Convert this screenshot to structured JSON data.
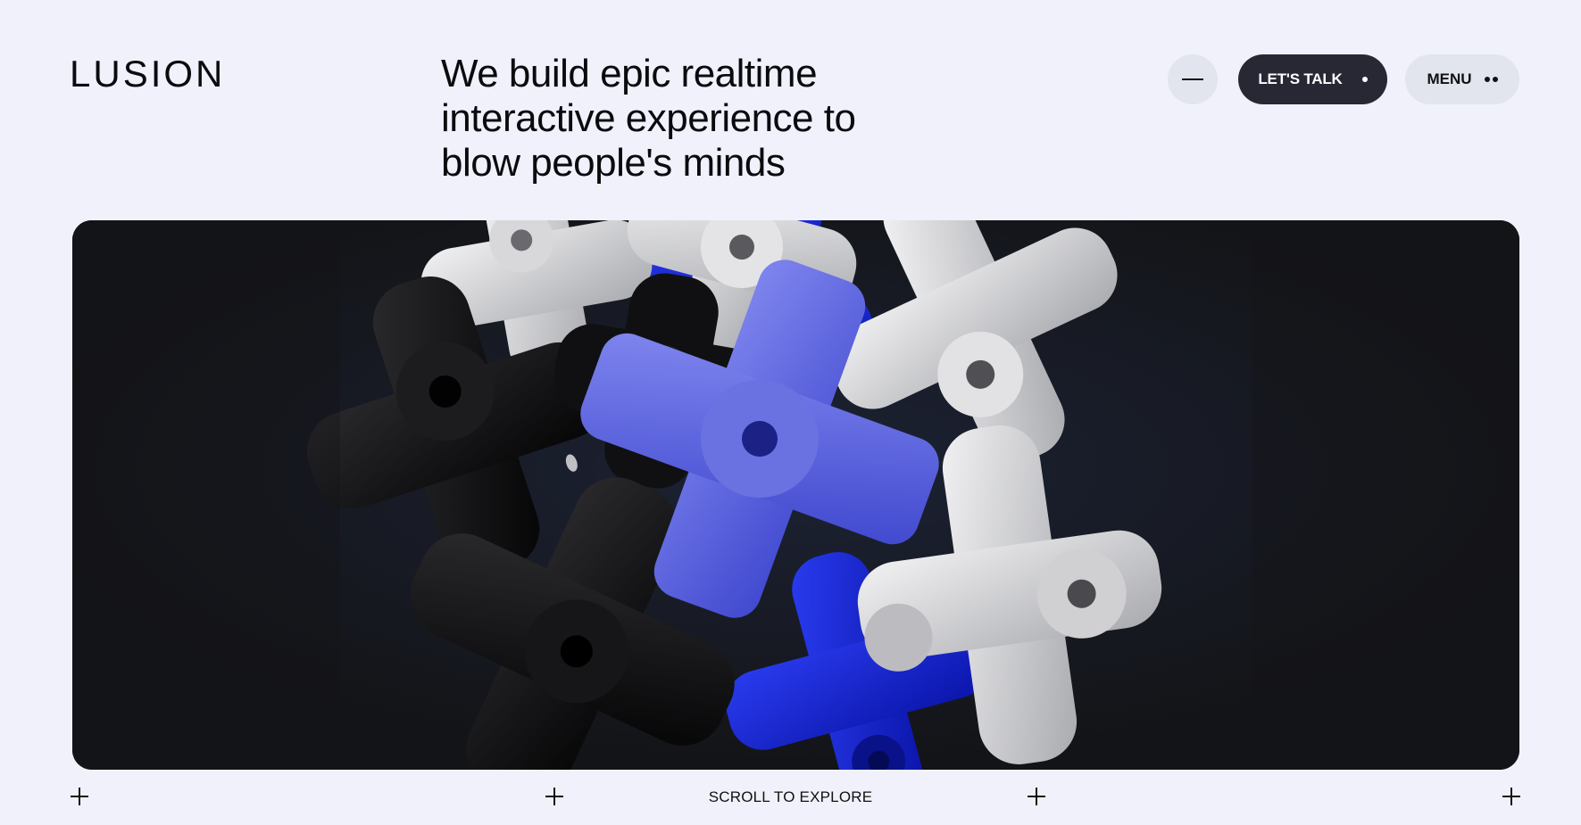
{
  "brand": {
    "logo_text": "LUSION"
  },
  "header": {
    "headline_lines": [
      "We build epic realtime",
      "interactive experience to",
      "blow people's minds"
    ],
    "sound_toggle_icon": "minus-icon",
    "talk_button_label": "LET'S TALK",
    "menu_button_label": "MENU"
  },
  "hero": {
    "image_description": "3D render of interlocking cross-shaped pieces in white, black and blue",
    "background_color": "#141518",
    "piece_colors": {
      "white": "#d9d9db",
      "black": "#0c0c0e",
      "blue": "#4a52d8",
      "deep_blue": "#0d1fcf"
    }
  },
  "footer": {
    "scroll_label": "SCROLL TO EXPLORE",
    "marker_icon": "plus-icon"
  },
  "colors": {
    "page_background": "#f0f1fa",
    "button_dark": "#272833",
    "button_light": "#e3e5ee",
    "text": "#0b0b0f"
  }
}
